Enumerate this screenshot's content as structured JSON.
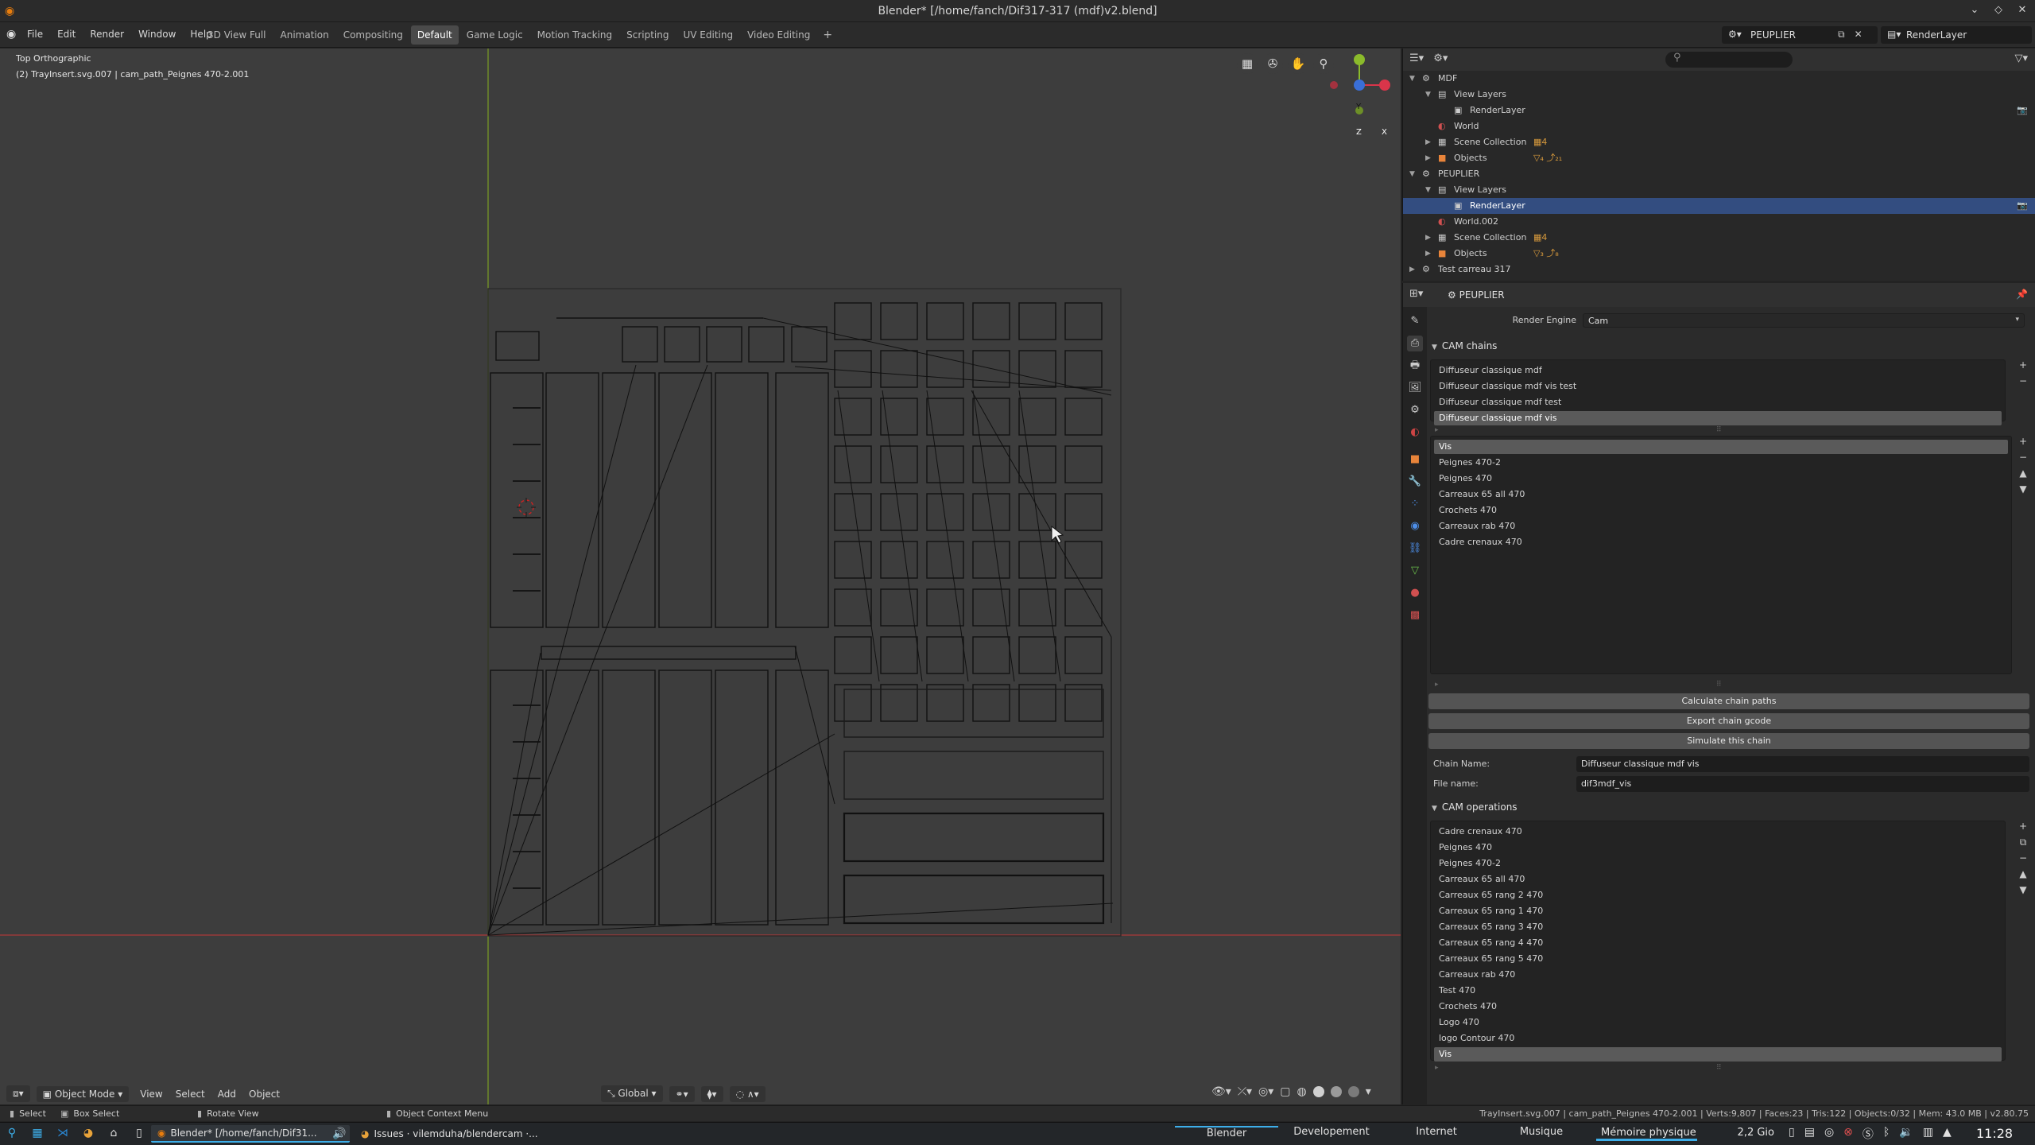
{
  "window": {
    "title": "Blender* [/home/fanch/Dif317-317 (mdf)v2.blend]"
  },
  "menu": {
    "items": [
      "File",
      "Edit",
      "Render",
      "Window",
      "Help"
    ],
    "workspaces": [
      "3D View Full",
      "Animation",
      "Compositing",
      "Default",
      "Game Logic",
      "Motion Tracking",
      "Scripting",
      "UV Editing",
      "Video Editing"
    ],
    "active_workspace": "Default",
    "add_workspace": "+",
    "scene": "PEUPLIER",
    "view_layer": "RenderLayer"
  },
  "viewport": {
    "view_name": "Top Orthographic",
    "object_info": "(2) TrayInsert.svg.007 | cam_path_Peignes 470-2.001",
    "mode": "Object Mode",
    "menus": [
      "View",
      "Select",
      "Add",
      "Object"
    ],
    "orientation": "Global",
    "gizmo": {
      "y": "Y",
      "z": "Z",
      "x": "X"
    }
  },
  "outliner": {
    "rows": [
      {
        "label": "MDF",
        "depth": 0,
        "icon": "scene-icon",
        "open": true
      },
      {
        "label": "View Layers",
        "depth": 1,
        "icon": "view-layers-icon",
        "open": true
      },
      {
        "label": "RenderLayer",
        "depth": 2,
        "icon": "render-layer-icon",
        "cam": true
      },
      {
        "label": "World",
        "depth": 1,
        "icon": "world-icon"
      },
      {
        "label": "Scene Collection",
        "depth": 1,
        "icon": "collection-icon",
        "closed": true,
        "extra": "▦4"
      },
      {
        "label": "Objects",
        "depth": 1,
        "icon": "objects-icon",
        "closed": true,
        "extra": "▽₄ ⤴₂₁"
      },
      {
        "label": "PEUPLIER",
        "depth": 0,
        "icon": "scene-icon",
        "open": true
      },
      {
        "label": "View Layers",
        "depth": 1,
        "icon": "view-layers-icon",
        "open": true
      },
      {
        "label": "RenderLayer",
        "depth": 2,
        "icon": "render-layer-icon",
        "cam": true,
        "selected": true
      },
      {
        "label": "World.002",
        "depth": 1,
        "icon": "world-icon"
      },
      {
        "label": "Scene Collection",
        "depth": 1,
        "icon": "collection-icon",
        "closed": true,
        "extra": "▦4"
      },
      {
        "label": "Objects",
        "depth": 1,
        "icon": "objects-icon",
        "closed": true,
        "extra": "▽₃ ⤴₈"
      },
      {
        "label": "Test carreau 317",
        "depth": 0,
        "icon": "scene-icon",
        "closed": true
      }
    ]
  },
  "properties": {
    "context": "PEUPLIER",
    "render_engine_label": "Render Engine",
    "render_engine": "Cam",
    "cam_chains_title": "CAM chains",
    "chains": [
      "Diffuseur classique mdf",
      "Diffuseur classique mdf vis test",
      "Diffuseur classique mdf  test",
      "Diffuseur classique mdf vis"
    ],
    "selected_chain": 3,
    "chain_ops": [
      "Vis",
      "Peignes 470-2",
      "Peignes 470",
      "Carreaux 65 all 470",
      "Crochets 470",
      "Carreaux rab 470",
      "Cadre crenaux 470"
    ],
    "selected_chain_op": 0,
    "buttons": {
      "calculate": "Calculate chain paths",
      "export": "Export chain gcode",
      "simulate": "Simulate this chain"
    },
    "chain_name_label": "Chain Name:",
    "chain_name": "Diffuseur classique mdf vis",
    "file_name_label": "File name:",
    "file_name": "dif3mdf_vis",
    "cam_operations_title": "CAM operations",
    "operations": [
      "Cadre crenaux 470",
      "Peignes 470",
      "Peignes 470-2",
      "Carreaux 65 all 470",
      "Carreaux 65 rang 2 470",
      "Carreaux 65 rang 1 470",
      "Carreaux 65 rang 3 470",
      "Carreaux 65 rang 4 470",
      "Carreaux 65 rang 5 470",
      "Carreaux rab 470",
      "Test 470",
      "Crochets 470",
      "Logo 470",
      "logo Contour 470",
      "Vis"
    ],
    "selected_operation": 14
  },
  "statusbar": {
    "select": "Select",
    "box_select": "Box Select",
    "rotate_view": "Rotate View",
    "context_menu": "Object Context Menu",
    "stats": "TrayInsert.svg.007 | cam_path_Peignes 470-2.001 | Verts:9,807 | Faces:23 | Tris:122 | Objects:0/32 | Mem: 43.0 MB | v2.80.75"
  },
  "taskbar": {
    "tasks": [
      "Blender* [/home/fanch/Dif31...",
      "Issues · vilemduha/blendercam ·..."
    ],
    "desktops": [
      "Blender",
      "Developement",
      "Internet",
      "Musique"
    ],
    "active_desktop": "Blender",
    "memory_label": "Mémoire physique",
    "memory_value": "2,2 Gio",
    "memory_fraction": 0.55,
    "clock": "11:28"
  }
}
